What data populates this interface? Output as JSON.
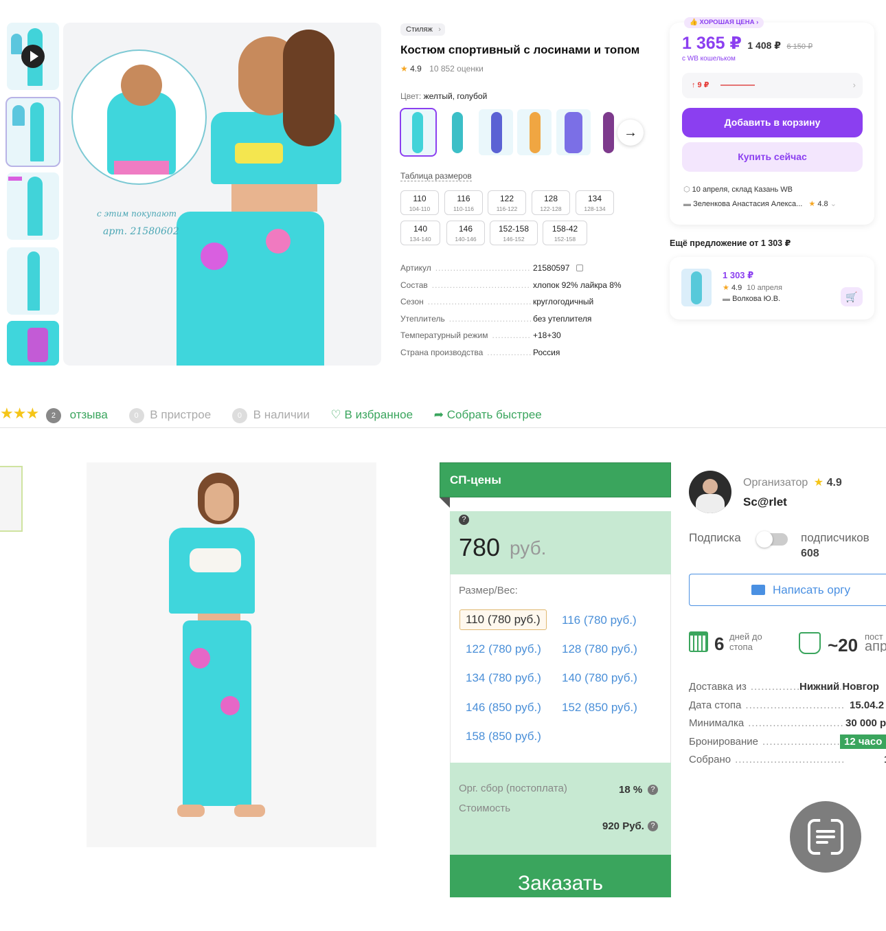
{
  "wb": {
    "brand": "Стиляж",
    "title": "Костюм спортивный с лосинами и топом",
    "rating": "4.9",
    "reviews": "10 852 оценки",
    "color_label": "Цвет:",
    "color_value": "желтый, голубой",
    "size_table": "Таблица размеров",
    "photo_caption_1": "с этим покупают",
    "photo_caption_2": "арт. 21580602",
    "sizes": [
      {
        "a": "110",
        "b": "104-110"
      },
      {
        "a": "116",
        "b": "110-116"
      },
      {
        "a": "122",
        "b": "116-122"
      },
      {
        "a": "128",
        "b": "122-128"
      },
      {
        "a": "134",
        "b": "128-134"
      },
      {
        "a": "140",
        "b": "134-140"
      },
      {
        "a": "146",
        "b": "140-146"
      },
      {
        "a": "152-158",
        "b": "146-152"
      },
      {
        "a": "158-42",
        "b": "152-158"
      }
    ],
    "specs": [
      {
        "k": "Артикул",
        "v": "21580597"
      },
      {
        "k": "Состав",
        "v": "хлопок 92% лайкра 8%"
      },
      {
        "k": "Сезон",
        "v": "круглогодичный"
      },
      {
        "k": "Утеплитель",
        "v": "без утеплителя"
      },
      {
        "k": "Температурный режим",
        "v": "+18+30"
      },
      {
        "k": "Страна производства",
        "v": "Россия"
      }
    ],
    "good_price": "ХОРОШАЯ ЦЕНА",
    "price": "1 365 ₽",
    "price_alt": "1 408 ₽",
    "price_old": "6 150 ₽",
    "wallet": "с WB кошельком",
    "price_change": "↑ 9 ₽",
    "add_to_cart": "Добавить в корзину",
    "buy_now": "Купить сейчас",
    "delivery": "10 апреля, склад Казань WB",
    "seller": "Зеленкова Анастасия Алекса...",
    "seller_rating": "4.8",
    "more_offers": "Ещё предложение от 1 303 ₽",
    "offer_price": "1 303 ₽",
    "offer_rating": "4.9",
    "offer_date": "10 апреля",
    "offer_seller": "Волкова Ю.В."
  },
  "sp": {
    "reviews_count": "2",
    "reviews_label": "отзыва",
    "in_attach_count": "0",
    "in_attach": "В пристрое",
    "in_stock_count": "0",
    "in_stock": "В наличии",
    "favorite": "В избранное",
    "collect_faster": "Собрать быстрее",
    "panel_title": "СП-цены",
    "price": "780",
    "currency": "руб.",
    "size_label": "Размер/Вес:",
    "sizes": [
      "110 (780 руб.)",
      "116 (780 руб.)",
      "122 (780 руб.)",
      "128 (780 руб.)",
      "134 (780 руб.)",
      "140 (780 руб.)",
      "146 (850 руб.)",
      "152 (850 руб.)",
      "158 (850 руб.)"
    ],
    "org_fee_label": "Орг. сбор (постоплата)",
    "org_fee": "18 %",
    "cost_label": "Стоимость",
    "cost": "920 Руб.",
    "order": "Заказать",
    "organizer_label": "Организатор",
    "organizer_rating": "4.9",
    "organizer_name": "Sc@rlet",
    "subscription": "Подписка",
    "subscribers_label": "подписчиков",
    "subscribers": "608",
    "write_org": "Написать оргу",
    "days": "6",
    "days_label_1": "дней до",
    "days_label_2": "стопа",
    "approx": "~20",
    "approx_label_1": "пост",
    "approx_label_2": "апр",
    "info": [
      {
        "k": "Доставка из",
        "v": "Нижний Новгор"
      },
      {
        "k": "Дата стопа",
        "v": "15.04.2"
      },
      {
        "k": "Минималка",
        "v": "30 000 р"
      },
      {
        "k": "Бронирование",
        "v": "12 часо"
      },
      {
        "k": "Собрано",
        "v": "1"
      }
    ]
  },
  "colors": {
    "wb_purple": "#8b3ff0",
    "sp_green": "#3aa55d",
    "sp_panel": "#c7e9d2",
    "suit_turquoise": "#3fd6dc"
  }
}
